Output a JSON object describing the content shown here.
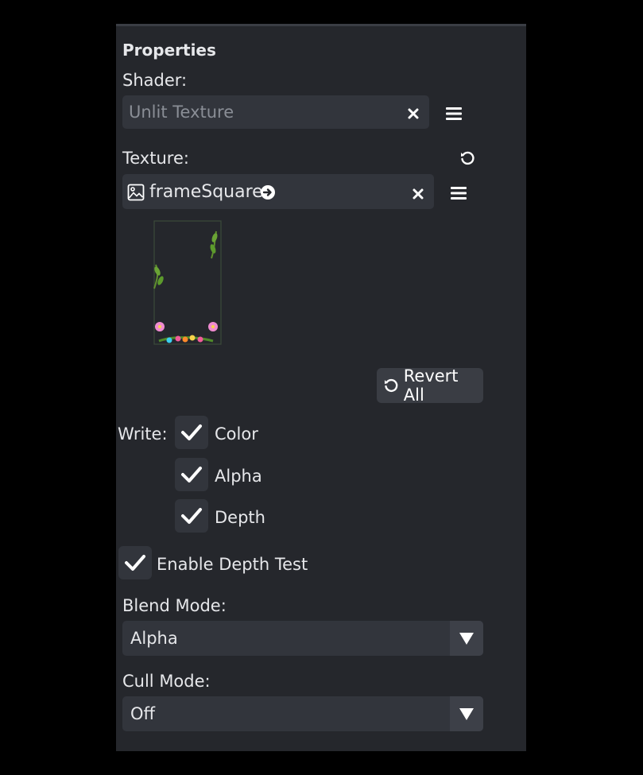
{
  "panel": {
    "title": "Properties",
    "shader": {
      "label": "Shader:",
      "placeholder": "Unlit Texture"
    },
    "texture": {
      "label": "Texture:",
      "value": "frameSquare"
    },
    "revert_all": "Revert All",
    "write": {
      "label": "Write:",
      "options": [
        {
          "label": "Color",
          "checked": true
        },
        {
          "label": "Alpha",
          "checked": true
        },
        {
          "label": "Depth",
          "checked": true
        }
      ]
    },
    "depth_test": {
      "label": "Enable Depth Test",
      "checked": true
    },
    "blend_mode": {
      "label": "Blend Mode:",
      "value": "Alpha"
    },
    "cull_mode": {
      "label": "Cull Mode:",
      "value": "Off"
    }
  },
  "icons": {
    "clear": "close-icon",
    "menu": "menu-icon",
    "reset": "reset-icon",
    "image": "image-icon",
    "go": "arrow-circle-right-icon",
    "check": "check-icon",
    "dropdown": "triangle-down-icon"
  },
  "colors": {
    "background": "#000000",
    "panel": "#25272c",
    "field": "#32353c",
    "button": "#3a3d44",
    "text": "#e6e7ea",
    "placeholder": "#8a8e96"
  }
}
